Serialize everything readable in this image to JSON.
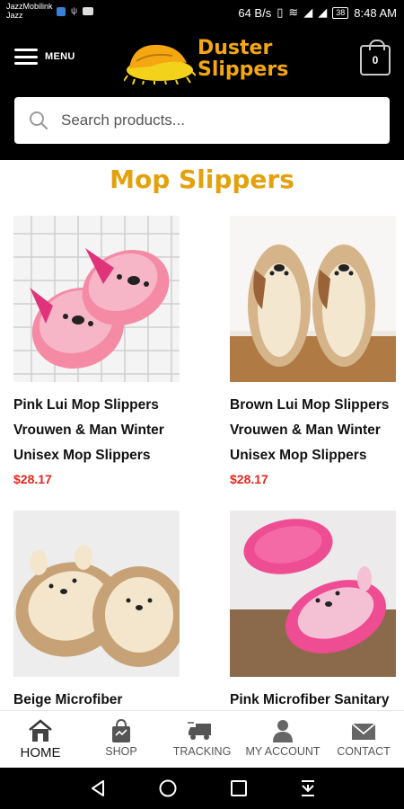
{
  "status_bar": {
    "carrier_line1": "JazzMobilink",
    "carrier_line2": "Jazz",
    "speed": "64 B/s",
    "battery": "38",
    "time": "8:48 AM"
  },
  "header": {
    "menu_label": "MENU",
    "logo_line1": "Duster",
    "logo_line2": "Slippers",
    "cart_count": "0",
    "brand_color": "#f5a712"
  },
  "search": {
    "placeholder": "Search products..."
  },
  "page": {
    "title": "Mop Slippers",
    "title_color": "#e3a20d",
    "price_color": "#e8261e"
  },
  "products": [
    {
      "name": "Pink Lui Mop Slippers Vrouwen & Man Winter Unisex Mop Slippers",
      "price": "$28.17"
    },
    {
      "name": "Brown Lui Mop Slippers Vrouwen & Man Winter Unisex Mop Slippers",
      "price": "$28.17"
    },
    {
      "name": "Beige Microfiber",
      "price": ""
    },
    {
      "name": "Pink Microfiber Sanitary Floor Cleaning",
      "price": ""
    }
  ],
  "bottom_nav": [
    {
      "label": "HOME",
      "icon": "home-icon"
    },
    {
      "label": "SHOP",
      "icon": "shopping-bag-icon"
    },
    {
      "label": "TRACKING",
      "icon": "delivery-truck-icon"
    },
    {
      "label": "MY ACCOUNT",
      "icon": "user-icon"
    },
    {
      "label": "CONTACT",
      "icon": "envelope-icon"
    }
  ],
  "system_nav": {
    "back": "back-icon",
    "home": "circle-home-icon",
    "recents": "square-recents-icon",
    "extra": "notification-pull-icon"
  }
}
